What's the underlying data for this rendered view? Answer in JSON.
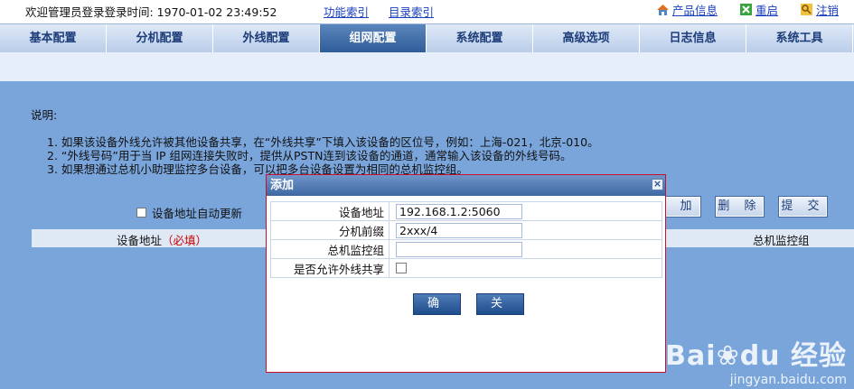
{
  "header": {
    "welcome": "欢迎管理员登录登录时间:  1970-01-02 23:49:52",
    "link_function_index": "功能索引",
    "link_directory_index": "目录索引",
    "product_info": "产品信息",
    "restart": "重启",
    "logout": "注销"
  },
  "nav": {
    "tabs": [
      "基本配置",
      "分机配置",
      "外线配置",
      "组网配置",
      "系统配置",
      "高级选项",
      "日志信息",
      "系统工具"
    ],
    "active_index": 3
  },
  "page": {
    "desc_title": "说明:",
    "notes": [
      "1.  如果该设备外线允许被其他设备共享，在“外线共享”下填入该设备的区位号，例如：上海-021，北京-010。",
      "2.  “外线号码”用于当 IP 组网连接失败时，提供从PSTN连到该设备的通道，通常输入该设备的外线号码。",
      "3.  如果想通过总机小助理监控多台设备，可以把多台设备设置为相同的总机监控组。"
    ],
    "auto_update_label": "设备地址自动更新",
    "btn_add": "添 加",
    "btn_delete": "删 除",
    "btn_submit": "提 交",
    "col_address": "设备地址",
    "col_address_required": "（必填）",
    "col_monitor_group": "总机监控组"
  },
  "modal": {
    "title": "添加",
    "close_glyph": "×",
    "fields": [
      {
        "label": "设备地址",
        "value": "192.168.1.2:5060"
      },
      {
        "label": "分机前缀",
        "value": "2xxx/4"
      },
      {
        "label": "总机监控组",
        "value": ""
      }
    ],
    "share_label": "是否允许外线共享",
    "btn_ok": "确 定",
    "btn_close": "关 闭"
  },
  "watermark": {
    "brand": "Bai",
    "brand2": "du",
    "brand_cn": "经验",
    "url": "jingyan.baidu.com"
  },
  "colors": {
    "accent": "#2f5d98",
    "content_bg": "#7aa5db",
    "modal_border": "#c8102e",
    "required": "#cc0000"
  }
}
